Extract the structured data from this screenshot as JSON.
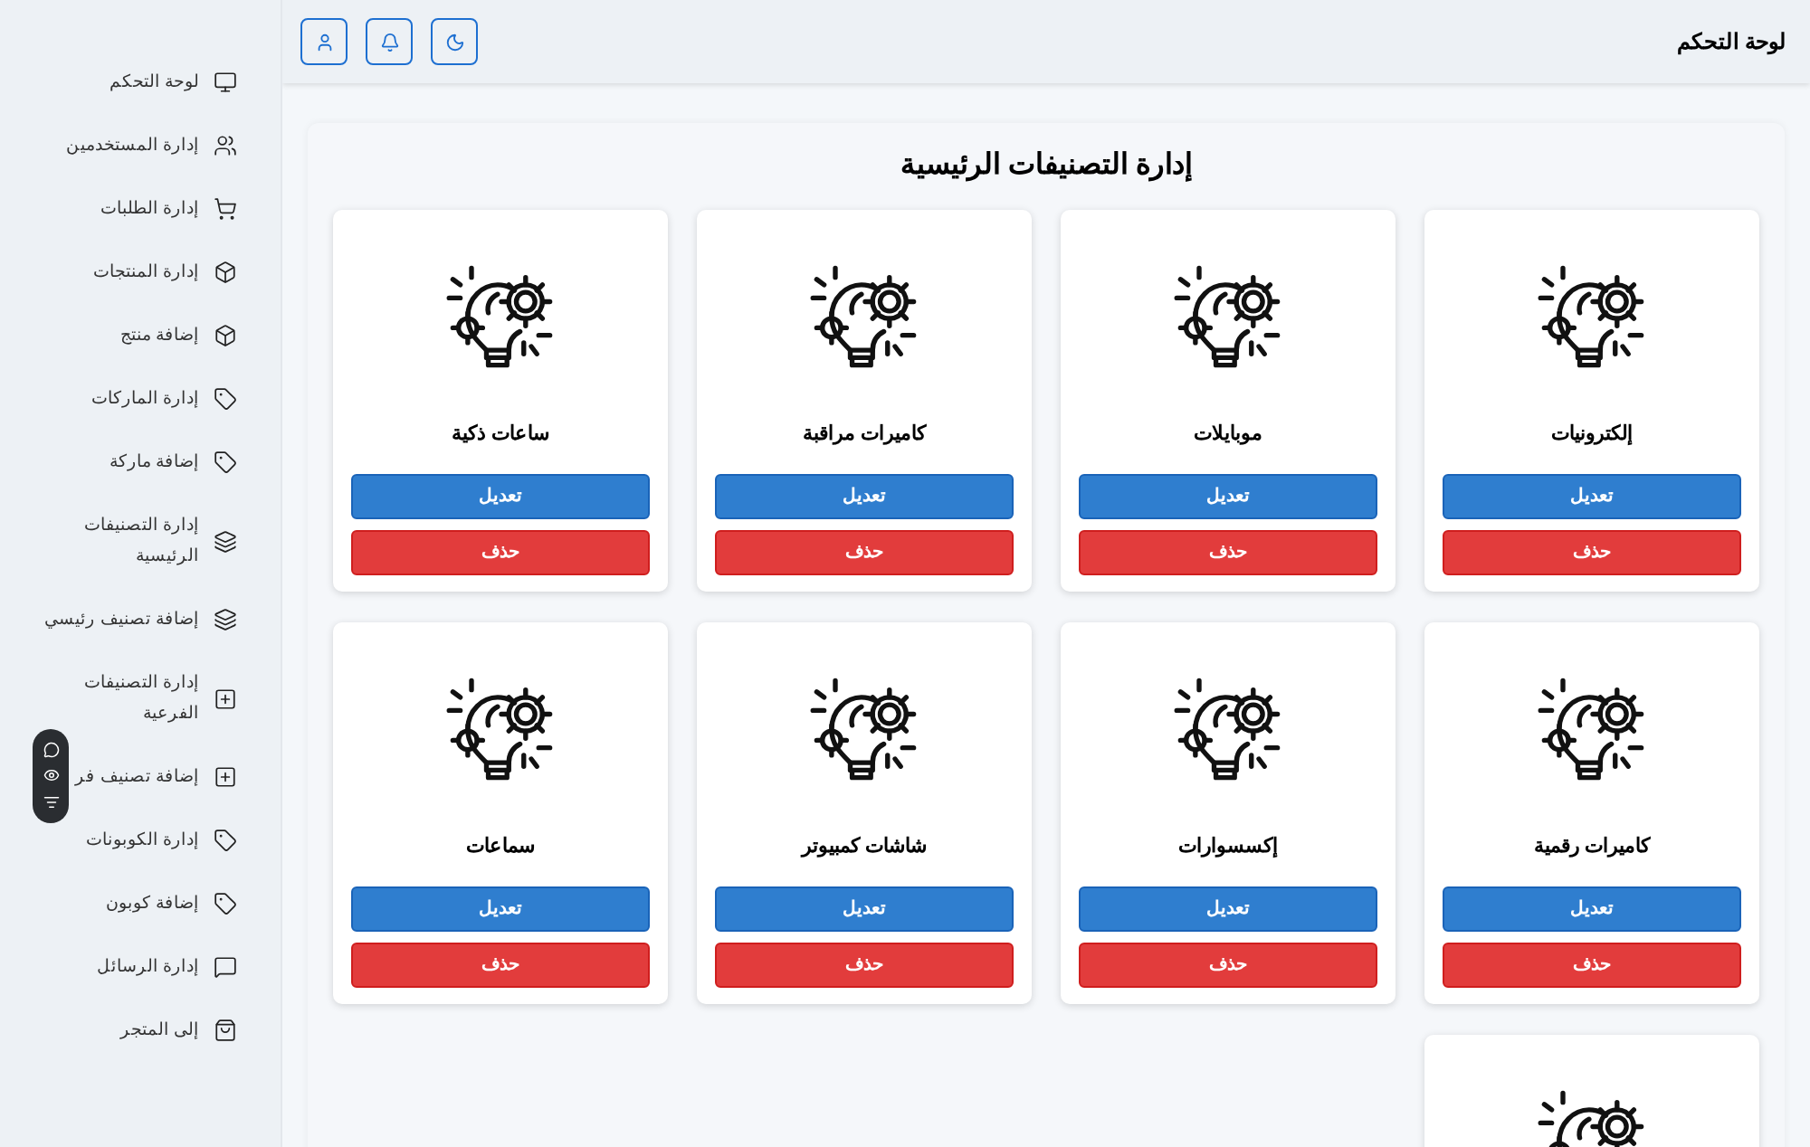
{
  "topbar": {
    "title": "لوحة التحكم",
    "buttons": [
      {
        "kind": "theme"
      },
      {
        "kind": "notifications"
      },
      {
        "kind": "profile"
      }
    ]
  },
  "sidebar": {
    "items": [
      {
        "label": "لوحة التحكم"
      },
      {
        "label": "إدارة المستخدمين"
      },
      {
        "label": "إدارة الطلبات"
      },
      {
        "label": "إدارة المنتجات"
      },
      {
        "label": "إضافة منتج"
      },
      {
        "label": "إدارة الماركات"
      },
      {
        "label": "إضافة ماركة"
      },
      {
        "label": "إدارة التصنيفات الرئيسية"
      },
      {
        "label": "إضافة تصنيف رئيسي"
      },
      {
        "label": "إدارة التصنيفات الفرعية"
      },
      {
        "label": "إضافة تصنيف فر"
      },
      {
        "label": "إدارة الكوبونات"
      },
      {
        "label": "إضافة كوبون"
      },
      {
        "label": "إدارة الرسائل"
      },
      {
        "label": "إلى المتجر"
      }
    ]
  },
  "panel": {
    "title": "إدارة التصنيفات الرئيسية",
    "categories": [
      {
        "kind": "full",
        "name": "إلكترونيات",
        "edit": "تعديل",
        "delete": "حذف"
      },
      {
        "kind": "full",
        "name": "موبايلات",
        "edit": "تعديل",
        "delete": "حذف"
      },
      {
        "kind": "full",
        "name": "كاميرات مراقبة",
        "edit": "تعديل",
        "delete": "حذف"
      },
      {
        "kind": "full",
        "name": "ساعات ذكية",
        "edit": "تعديل",
        "delete": "حذف"
      },
      {
        "kind": "full",
        "name": "كاميرات رقمية",
        "edit": "تعديل",
        "delete": "حذف"
      },
      {
        "kind": "full",
        "name": "إكسسوارات",
        "edit": "تعديل",
        "delete": "حذف"
      },
      {
        "kind": "full",
        "name": "شاشات كمبيوتر",
        "edit": "تعديل",
        "delete": "حذف"
      },
      {
        "kind": "full",
        "name": "سماعات",
        "edit": "تعديل",
        "delete": "حذف"
      },
      {
        "kind": "partial"
      }
    ]
  }
}
